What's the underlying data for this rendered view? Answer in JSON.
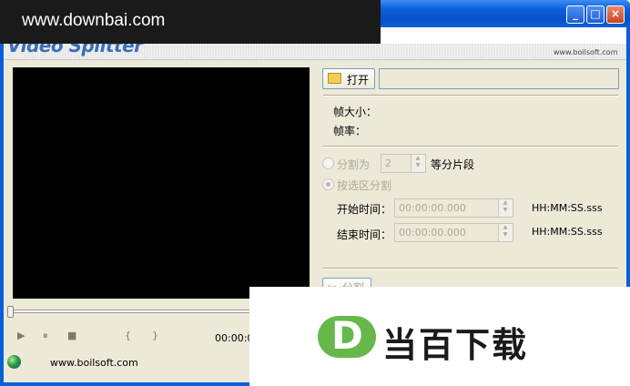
{
  "banner": {
    "logo_text": "Video Splitter",
    "url": "www.boilsoft.com"
  },
  "watermark": {
    "top_text": "www.downbai.com",
    "logo_letter": "D",
    "brand_text": "当百下载"
  },
  "window_buttons": {
    "minimize": "_",
    "maximize": "□",
    "close": "×"
  },
  "file": {
    "open_label": "打开",
    "path_value": ""
  },
  "info": {
    "frame_size_label": "帧大小：",
    "frame_rate_label": "帧率："
  },
  "split_mode": {
    "split_into_label": "分割为",
    "parts_value": "2",
    "parts_suffix": "等分片段",
    "by_range_label": "按选区分割",
    "start_label": "开始时间：",
    "start_value": "00:00:00.000",
    "end_label": "结束时间：",
    "end_value": "00:00:00.000",
    "time_format": "HH:MM:SS.sss"
  },
  "actions": {
    "split_label": "分割"
  },
  "player": {
    "play_icon": "▶",
    "pause_icon": "⏸",
    "stop_icon": "■",
    "mark_in": "{",
    "mark_out": "}",
    "time": "00:00:0"
  },
  "footer": {
    "url": "www.boilsoft.com"
  }
}
